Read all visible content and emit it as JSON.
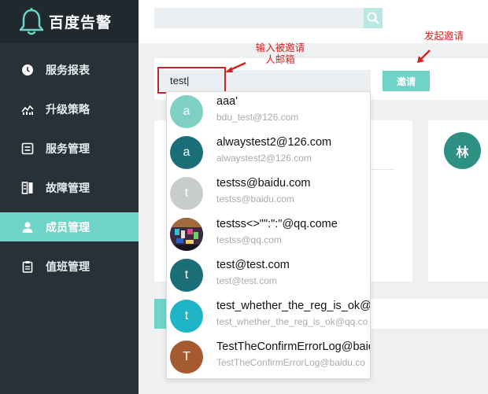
{
  "brand": {
    "name": "百度告警"
  },
  "sidebar": {
    "items": [
      {
        "label": "服务报表",
        "icon": "clock-icon"
      },
      {
        "label": "升级策略",
        "icon": "chart-line-icon"
      },
      {
        "label": "服务管理",
        "icon": "list-box-icon"
      },
      {
        "label": "故障管理",
        "icon": "server-icon"
      },
      {
        "label": "成员管理",
        "icon": "user-icon",
        "active": true
      },
      {
        "label": "值班管理",
        "icon": "clipboard-icon"
      }
    ]
  },
  "header": {
    "search_placeholder": "",
    "search_icon": "search-icon"
  },
  "invite": {
    "input_value": "test|",
    "button_label": "邀请",
    "annotation_input_line1": "输入被邀请",
    "annotation_input_line2": "人邮箱",
    "annotation_button": "发起邀请"
  },
  "card2": {
    "avatar_text": "林"
  },
  "dropdown": {
    "items": [
      {
        "avatar": "a",
        "name": "aaa'",
        "email": "bdu_test@126.com",
        "color": "#7ed0c4"
      },
      {
        "avatar": "a",
        "name": "alwaystest2@126.com",
        "email": "alwaystest2@126.com",
        "color": "#1a6e78"
      },
      {
        "avatar": "t",
        "name": "testss@baidu.com",
        "email": "testss@baidu.com",
        "color": "#c9cccd"
      },
      {
        "avatar": "",
        "name": "testss<>\"\":\":\"@qq.come",
        "email": "testss@qq.com",
        "color": "#3a2a44"
      },
      {
        "avatar": "t",
        "name": "test@test.com",
        "email": "test@test.com",
        "color": "#1a6e78"
      },
      {
        "avatar": "t",
        "name": "test_whether_the_reg_is_ok@",
        "email": "test_whether_the_reg_is_ok@qq.co",
        "color": "#1fb5c9"
      },
      {
        "avatar": "T",
        "name": "TestTheConfirmErrorLog@baid",
        "email": "TestTheConfirmErrorLog@baidu.co",
        "color": "#a65a2f"
      }
    ]
  },
  "colors": {
    "sidebar": "#263238",
    "accent": "#6fd3c8",
    "annotation": "#d2241f"
  }
}
